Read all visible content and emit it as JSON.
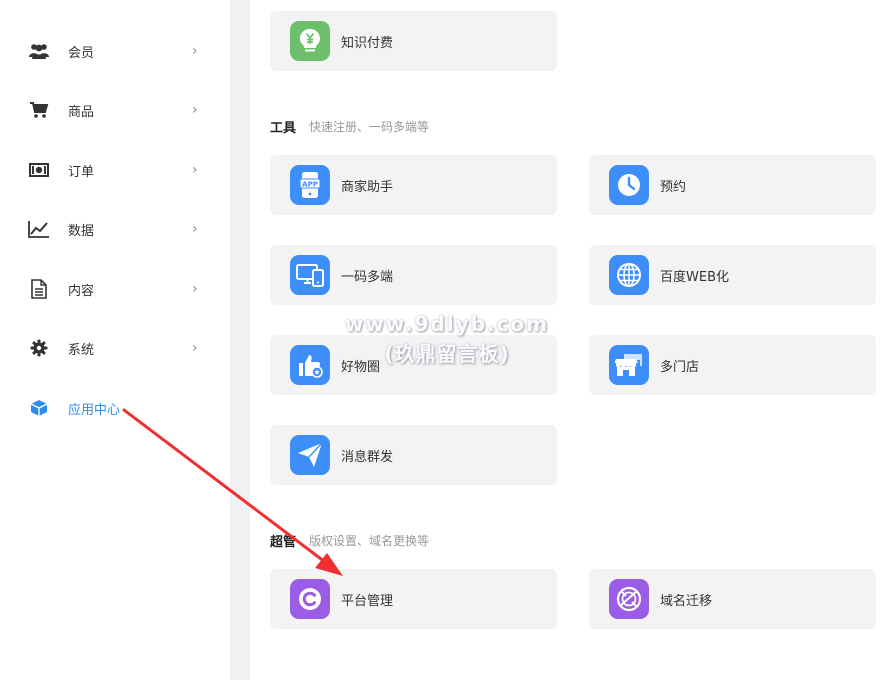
{
  "sidebar": {
    "items": [
      {
        "label": "会员",
        "icon": "users-icon"
      },
      {
        "label": "商品",
        "icon": "cart-icon"
      },
      {
        "label": "订单",
        "icon": "money-icon"
      },
      {
        "label": "数据",
        "icon": "chart-line-icon"
      },
      {
        "label": "内容",
        "icon": "document-icon"
      },
      {
        "label": "系统",
        "icon": "gear-icon"
      },
      {
        "label": "应用中心",
        "icon": "cube-icon",
        "active": true
      }
    ],
    "arrow_glyph": "›"
  },
  "main": {
    "top_card": {
      "label": "知识付费",
      "icon": "yen-bulb-icon"
    },
    "tools": {
      "title": "工具",
      "subtitle": "快速注册、一码多端等",
      "cards": [
        {
          "label": "商家助手",
          "icon": "app-phone-icon"
        },
        {
          "label": "预约",
          "icon": "clock-icon"
        },
        {
          "label": "一码多端",
          "icon": "multi-device-icon"
        },
        {
          "label": "百度WEB化",
          "icon": "globe-icon"
        },
        {
          "label": "好物圈",
          "icon": "thumb-up-icon"
        },
        {
          "label": "多门店",
          "icon": "store-icon"
        },
        {
          "label": "消息群发",
          "icon": "paper-plane-icon"
        }
      ]
    },
    "admin": {
      "title": "超管",
      "subtitle": "版权设置、域名更换等",
      "cards": [
        {
          "label": "平台管理",
          "icon": "c-logo-icon"
        },
        {
          "label": "域名迁移",
          "icon": "compass-icon"
        }
      ]
    }
  },
  "watermark": {
    "line1": "www.9dlyb.com",
    "line2": "(玖鼎留言板)"
  },
  "colors": {
    "active": "#2d8cf0",
    "icon_blue": "#3d8ef8",
    "icon_green": "#6cc06c",
    "icon_purple": "#9b5de5",
    "annotation_arrow": "#f03030"
  }
}
